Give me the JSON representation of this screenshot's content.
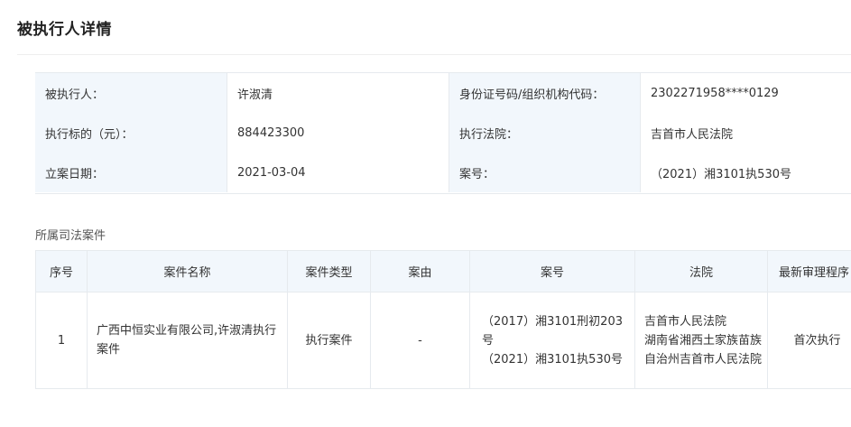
{
  "page": {
    "title": "被执行人详情"
  },
  "details": {
    "rows": [
      {
        "label1": "被执行人：",
        "value1": "许淑清",
        "label2": "身份证号码/组织机构代码：",
        "value2": "2302271958****0129"
      },
      {
        "label1": "执行标的（元）：",
        "value1": "884423300",
        "label2": "执行法院：",
        "value2": "吉首市人民法院"
      },
      {
        "label1": "立案日期：",
        "value1": "2021-03-04",
        "label2": "案号：",
        "value2": "（2021）湘3101执530号"
      }
    ]
  },
  "cases": {
    "section_title": "所属司法案件",
    "headers": [
      "序号",
      "案件名称",
      "案件类型",
      "案由",
      "案号",
      "法院",
      "最新审理程序"
    ],
    "rows": [
      {
        "index": "1",
        "name": "广西中恒实业有限公司,许淑清执行案件",
        "type": "执行案件",
        "cause": "-",
        "case_no_1": "（2017）湘3101刑初203号",
        "case_no_2": "（2021）湘3101执530号",
        "court_1": "吉首市人民法院",
        "court_2": "湖南省湘西土家族苗族自治州吉首市人民法院",
        "procedure": "首次执行"
      }
    ]
  },
  "colors": {
    "link": "#1f7ce0",
    "label_bg": "#f2f7fc",
    "border": "#e6eaee"
  }
}
